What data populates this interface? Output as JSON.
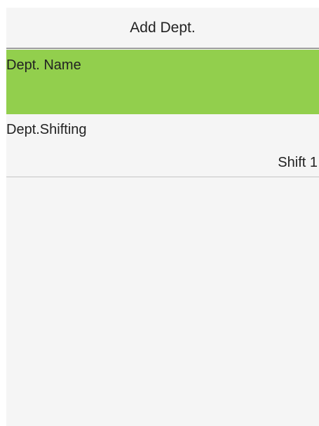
{
  "header": {
    "title": "Add Dept."
  },
  "form": {
    "dept_name": {
      "label": "Dept. Name",
      "value": ""
    },
    "dept_shifting": {
      "label": "Dept.Shifting",
      "value": "Shift 1"
    }
  },
  "colors": {
    "selected_row": "#92cf4d",
    "background": "#f5f5f5"
  }
}
